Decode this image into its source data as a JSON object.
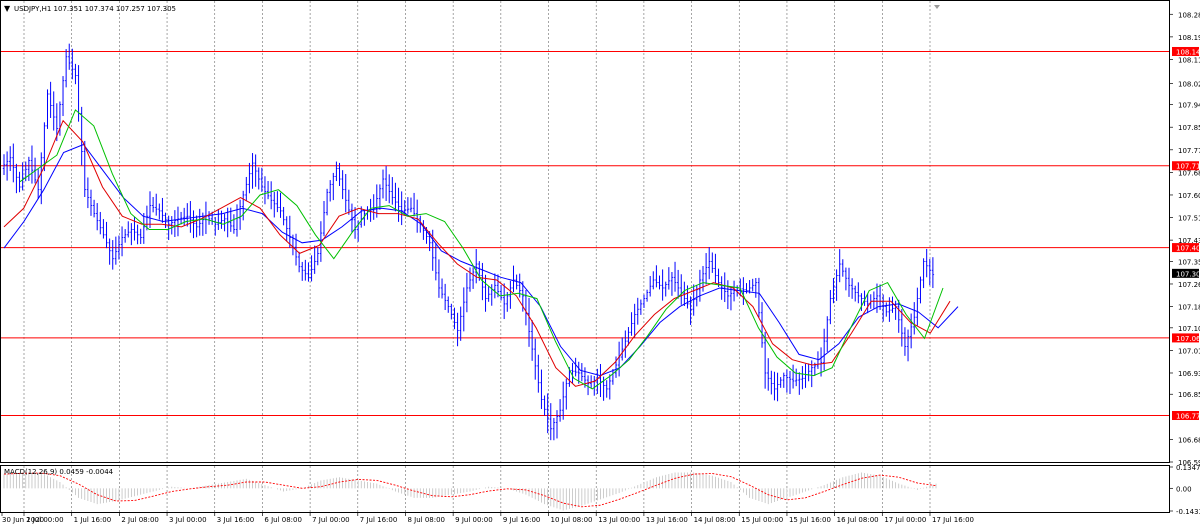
{
  "header": {
    "menu_glyph": "▼",
    "title": "USDJPY,H1  107.351 107.374 107.257 107.305"
  },
  "price_axis": {
    "labels": [
      "108.280",
      "108.195",
      "108.110",
      "108.020",
      "107.940",
      "107.855",
      "107.770",
      "107.685",
      "107.600",
      "107.515",
      "107.430",
      "107.350",
      "107.265",
      "107.180",
      "107.100",
      "107.015",
      "106.930",
      "106.850",
      "106.680",
      "106.595"
    ]
  },
  "levels": [
    {
      "label": "108.140",
      "value": 108.14
    },
    {
      "label": "107.710",
      "value": 107.71
    },
    {
      "label": "107.402",
      "value": 107.402
    },
    {
      "label": "107.062",
      "value": 107.062
    },
    {
      "label": "106.770",
      "value": 106.77
    }
  ],
  "current_price": {
    "label": "107.305",
    "value": 107.305
  },
  "time_axis": {
    "labels": [
      "30 Jun 2020",
      "1 Jul 00:00",
      "1 Jul 16:00",
      "2 Jul 08:00",
      "3 Jul 00:00",
      "3 Jul 16:00",
      "6 Jul 08:00",
      "7 Jul 00:00",
      "7 Jul 16:00",
      "8 Jul 08:00",
      "9 Jul 00:00",
      "9 Jul 16:00",
      "10 Jul 08:00",
      "13 Jul 00:00",
      "13 Jul 16:00",
      "14 Jul 08:00",
      "15 Jul 00:00",
      "15 Jul 16:00",
      "16 Jul 08:00",
      "17 Jul 00:00",
      "17 Jul 16:00"
    ]
  },
  "macd": {
    "label": "MACD(12,26,9) 0.0459 -0.0044",
    "axis_labels": [
      "0.1347",
      "0.00",
      "-0.1433"
    ]
  },
  "colors": {
    "price_bars": "#0000ff",
    "ma_fast": "#00c000",
    "ma_mid": "#e00000",
    "ma_slow": "#0000ff",
    "level_line": "#ff0000",
    "current_label_bg": "#000000",
    "grid": "#6b6b6b",
    "macd_signal": "#ff0000"
  },
  "chart_data": {
    "type": "candlestick",
    "symbol": "USDJPY",
    "timeframe": "H1",
    "ylim": [
      106.595,
      108.33
    ],
    "series": [
      {
        "name": "close",
        "values": [
          107.7,
          107.74,
          107.63,
          107.73,
          107.62,
          107.98,
          107.85,
          108.12,
          108.05,
          107.62,
          107.53,
          107.45,
          107.36,
          107.44,
          107.47,
          107.44,
          107.56,
          107.54,
          107.49,
          107.51,
          107.52,
          107.48,
          107.52,
          107.49,
          107.51,
          107.47,
          107.6,
          107.72,
          107.63,
          107.58,
          107.54,
          107.44,
          107.33,
          107.29,
          107.38,
          107.61,
          107.7,
          107.58,
          107.47,
          107.53,
          107.55,
          107.66,
          107.59,
          107.54,
          107.55,
          107.49,
          107.42,
          107.25,
          107.18,
          107.09,
          107.25,
          107.34,
          107.21,
          107.26,
          107.19,
          107.28,
          107.22,
          107.02,
          106.83,
          106.72,
          106.79,
          106.94,
          106.93,
          106.89,
          106.91,
          106.87,
          106.96,
          107.05,
          107.15,
          107.21,
          107.28,
          107.25,
          107.29,
          107.23,
          107.17,
          107.28,
          107.35,
          107.27,
          107.22,
          107.25,
          107.24,
          107.27,
          106.93,
          106.87,
          106.92,
          106.9,
          106.91,
          106.95,
          106.97,
          107.21,
          107.34,
          107.26,
          107.22,
          107.19,
          107.22,
          107.16,
          107.18,
          107.03,
          107.14,
          107.35,
          107.3
        ]
      },
      {
        "name": "MA fast",
        "values": [
          107.65,
          107.7,
          107.75,
          107.92,
          107.86,
          107.68,
          107.53,
          107.47,
          107.47,
          107.5,
          107.51,
          107.49,
          107.52,
          107.6,
          107.62,
          107.56,
          107.45,
          107.36,
          107.46,
          107.55,
          107.56,
          107.52,
          107.53,
          107.5,
          107.4,
          107.28,
          107.22,
          107.23,
          107.21,
          107.05,
          106.91,
          106.87,
          106.92,
          106.98,
          107.07,
          107.17,
          107.24,
          107.27,
          107.26,
          107.25,
          107.1,
          106.99,
          106.93,
          106.92,
          106.95,
          107.1,
          107.24,
          107.27,
          107.15,
          107.06,
          107.25
        ]
      },
      {
        "name": "MA mid",
        "values": [
          107.48,
          107.55,
          107.7,
          107.88,
          107.8,
          107.63,
          107.52,
          107.49,
          107.49,
          107.48,
          107.51,
          107.55,
          107.59,
          107.55,
          107.45,
          107.38,
          107.41,
          107.52,
          107.55,
          107.53,
          107.53,
          107.51,
          107.42,
          107.34,
          107.29,
          107.28,
          107.22,
          107.1,
          106.95,
          106.88,
          106.9,
          106.97,
          107.07,
          107.15,
          107.21,
          107.24,
          107.27,
          107.25,
          107.18,
          107.04,
          106.98,
          106.96,
          106.97,
          107.08,
          107.2,
          107.2,
          107.12,
          107.08,
          107.2
        ]
      },
      {
        "name": "MA slow",
        "values": [
          107.4,
          107.5,
          107.62,
          107.76,
          107.79,
          107.69,
          107.59,
          107.52,
          107.5,
          107.51,
          107.52,
          107.53,
          107.55,
          107.53,
          107.46,
          107.42,
          107.43,
          107.48,
          107.54,
          107.55,
          107.54,
          107.49,
          107.39,
          107.35,
          107.32,
          107.29,
          107.27,
          107.18,
          107.03,
          106.94,
          106.92,
          106.95,
          107.03,
          107.12,
          107.18,
          107.22,
          107.25,
          107.24,
          107.23,
          107.12,
          107.0,
          106.98,
          107.04,
          107.14,
          107.18,
          107.19,
          107.16,
          107.1,
          107.18
        ]
      },
      {
        "name": "MACD",
        "values": [
          0.09,
          0.1,
          0.1,
          0.04,
          -0.06,
          -0.1,
          -0.08,
          -0.05,
          -0.02,
          0.01,
          0.0,
          0.02,
          0.04,
          0.06,
          0.02,
          -0.02,
          0.0,
          0.05,
          0.07,
          0.05,
          0.03,
          -0.02,
          -0.06,
          -0.06,
          -0.04,
          -0.02,
          0.01,
          0.0,
          -0.04,
          -0.1,
          -0.14,
          -0.11,
          -0.07,
          -0.03,
          0.02,
          0.07,
          0.1,
          0.1,
          0.08,
          0.04,
          -0.06,
          -0.1,
          -0.06,
          -0.02,
          0.02,
          0.07,
          0.1,
          0.08,
          0.03,
          -0.01,
          0.03
        ]
      }
    ]
  }
}
